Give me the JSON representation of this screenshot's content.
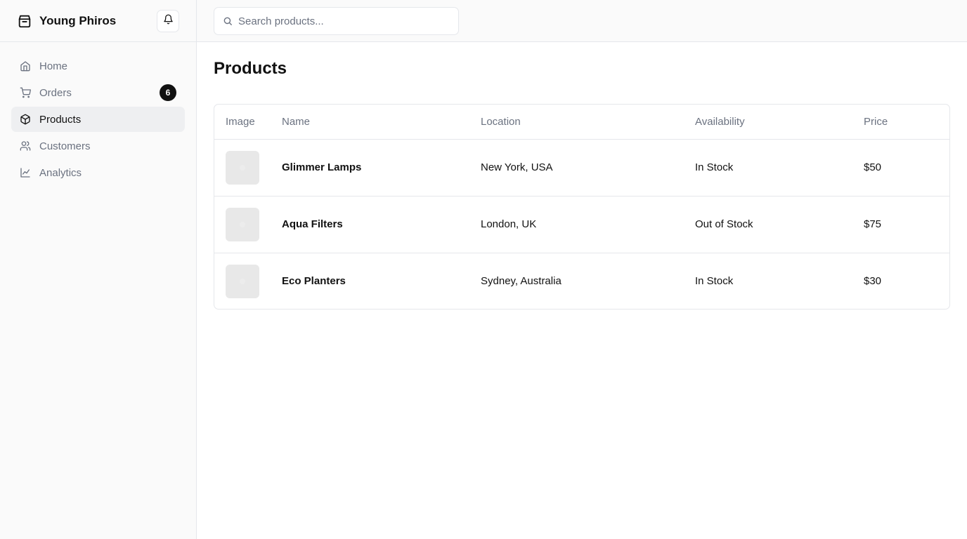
{
  "brand": {
    "name": "Young Phiros",
    "icon": "package-icon"
  },
  "notifications": {
    "icon": "bell-icon"
  },
  "nav": {
    "items": [
      {
        "label": "Home",
        "icon": "home-icon",
        "active": false
      },
      {
        "label": "Orders",
        "icon": "cart-icon",
        "active": false,
        "badge": "6"
      },
      {
        "label": "Products",
        "icon": "box-icon",
        "active": true
      },
      {
        "label": "Customers",
        "icon": "users-icon",
        "active": false
      },
      {
        "label": "Analytics",
        "icon": "chart-line-icon",
        "active": false
      }
    ]
  },
  "search": {
    "placeholder": "Search products...",
    "value": ""
  },
  "page": {
    "title": "Products"
  },
  "table": {
    "columns": [
      "Image",
      "Name",
      "Location",
      "Availability",
      "Price"
    ],
    "rows": [
      {
        "name": "Glimmer Lamps",
        "location": "New York, USA",
        "availability": "In Stock",
        "price": "$50"
      },
      {
        "name": "Aqua Filters",
        "location": "London, UK",
        "availability": "Out of Stock",
        "price": "$75"
      },
      {
        "name": "Eco Planters",
        "location": "Sydney, Australia",
        "availability": "In Stock",
        "price": "$30"
      }
    ]
  },
  "colors": {
    "accent": "#111111",
    "muted": "#6b7280",
    "border": "#e5e7eb",
    "sidebar_bg": "#fafafa",
    "active_bg": "#eeeff1"
  }
}
